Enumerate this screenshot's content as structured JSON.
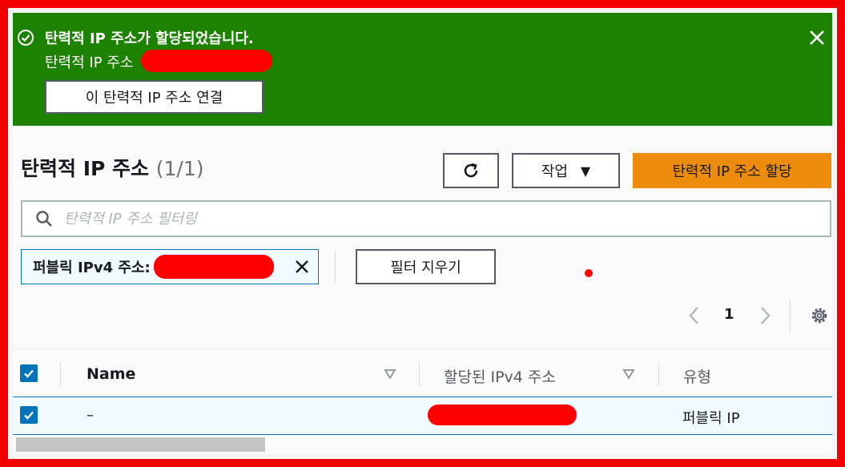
{
  "banner": {
    "title": "탄력적 IP 주소가 할당되었습니다.",
    "subtitle": "탄력적 IP 주소",
    "associate_button": "이 탄력적 IP 주소 연결",
    "color": "#1d8102"
  },
  "header": {
    "title": "탄력적 IP 주소",
    "count": "(1/1)",
    "actions_label": "작업",
    "allocate_label": "탄력적 IP 주소 할당"
  },
  "search": {
    "placeholder": "탄력적 IP 주소 필터링",
    "value": ""
  },
  "filter": {
    "token_label": "퍼블릭 IPv4 주소:",
    "clear_label": "필터 지우기"
  },
  "pagination": {
    "current_page": "1"
  },
  "table": {
    "columns": [
      "Name",
      "할당된 IPv4 주소",
      "유형"
    ],
    "rows": [
      {
        "name": "–",
        "type": "퍼블릭 IP",
        "selected": true
      }
    ],
    "header_checkbox_checked": true
  },
  "colors": {
    "frame": "#f40000",
    "primary": "#ec8b0c",
    "selection": "#0073bb",
    "redaction": "#ff0000"
  },
  "icons": [
    "check-circle-icon",
    "close-icon",
    "refresh-icon",
    "caret-down-icon",
    "search-icon",
    "chevron-left-icon",
    "chevron-right-icon",
    "settings-icon",
    "sort-icon",
    "checkbox-icon"
  ]
}
